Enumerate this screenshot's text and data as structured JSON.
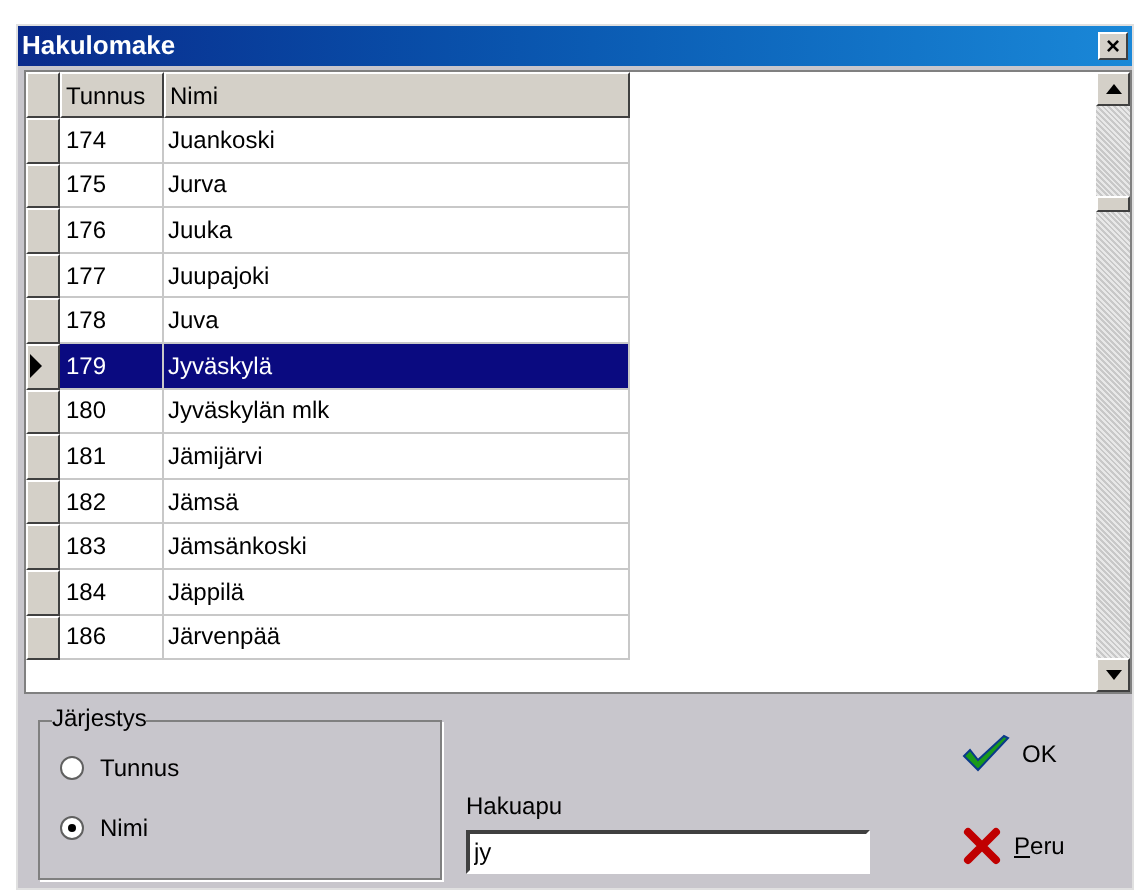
{
  "window": {
    "title": "Hakulomake",
    "close": "×"
  },
  "table": {
    "columns": [
      "Tunnus",
      "Nimi"
    ],
    "rows": [
      {
        "id": "174",
        "name": "Juankoski",
        "selected": false
      },
      {
        "id": "175",
        "name": "Jurva",
        "selected": false
      },
      {
        "id": "176",
        "name": "Juuka",
        "selected": false
      },
      {
        "id": "177",
        "name": "Juupajoki",
        "selected": false
      },
      {
        "id": "178",
        "name": "Juva",
        "selected": false
      },
      {
        "id": "179",
        "name": "Jyväskylä",
        "selected": true
      },
      {
        "id": "180",
        "name": "Jyväskylän mlk",
        "selected": false
      },
      {
        "id": "181",
        "name": "Jämijärvi",
        "selected": false
      },
      {
        "id": "182",
        "name": "Jämsä",
        "selected": false
      },
      {
        "id": "183",
        "name": "Jämsänkoski",
        "selected": false
      },
      {
        "id": "184",
        "name": "Jäppilä",
        "selected": false
      },
      {
        "id": "186",
        "name": "Järvenpää",
        "selected": false
      }
    ]
  },
  "order": {
    "title": "Järjestys",
    "options": [
      {
        "label": "Tunnus",
        "selected": false
      },
      {
        "label": "Nimi",
        "selected": true
      }
    ]
  },
  "search": {
    "label": "Hakuapu",
    "value": "jy"
  },
  "buttons": [
    {
      "kind": "ok",
      "label": "OK"
    },
    {
      "kind": "cancel",
      "label": "Peru"
    }
  ]
}
